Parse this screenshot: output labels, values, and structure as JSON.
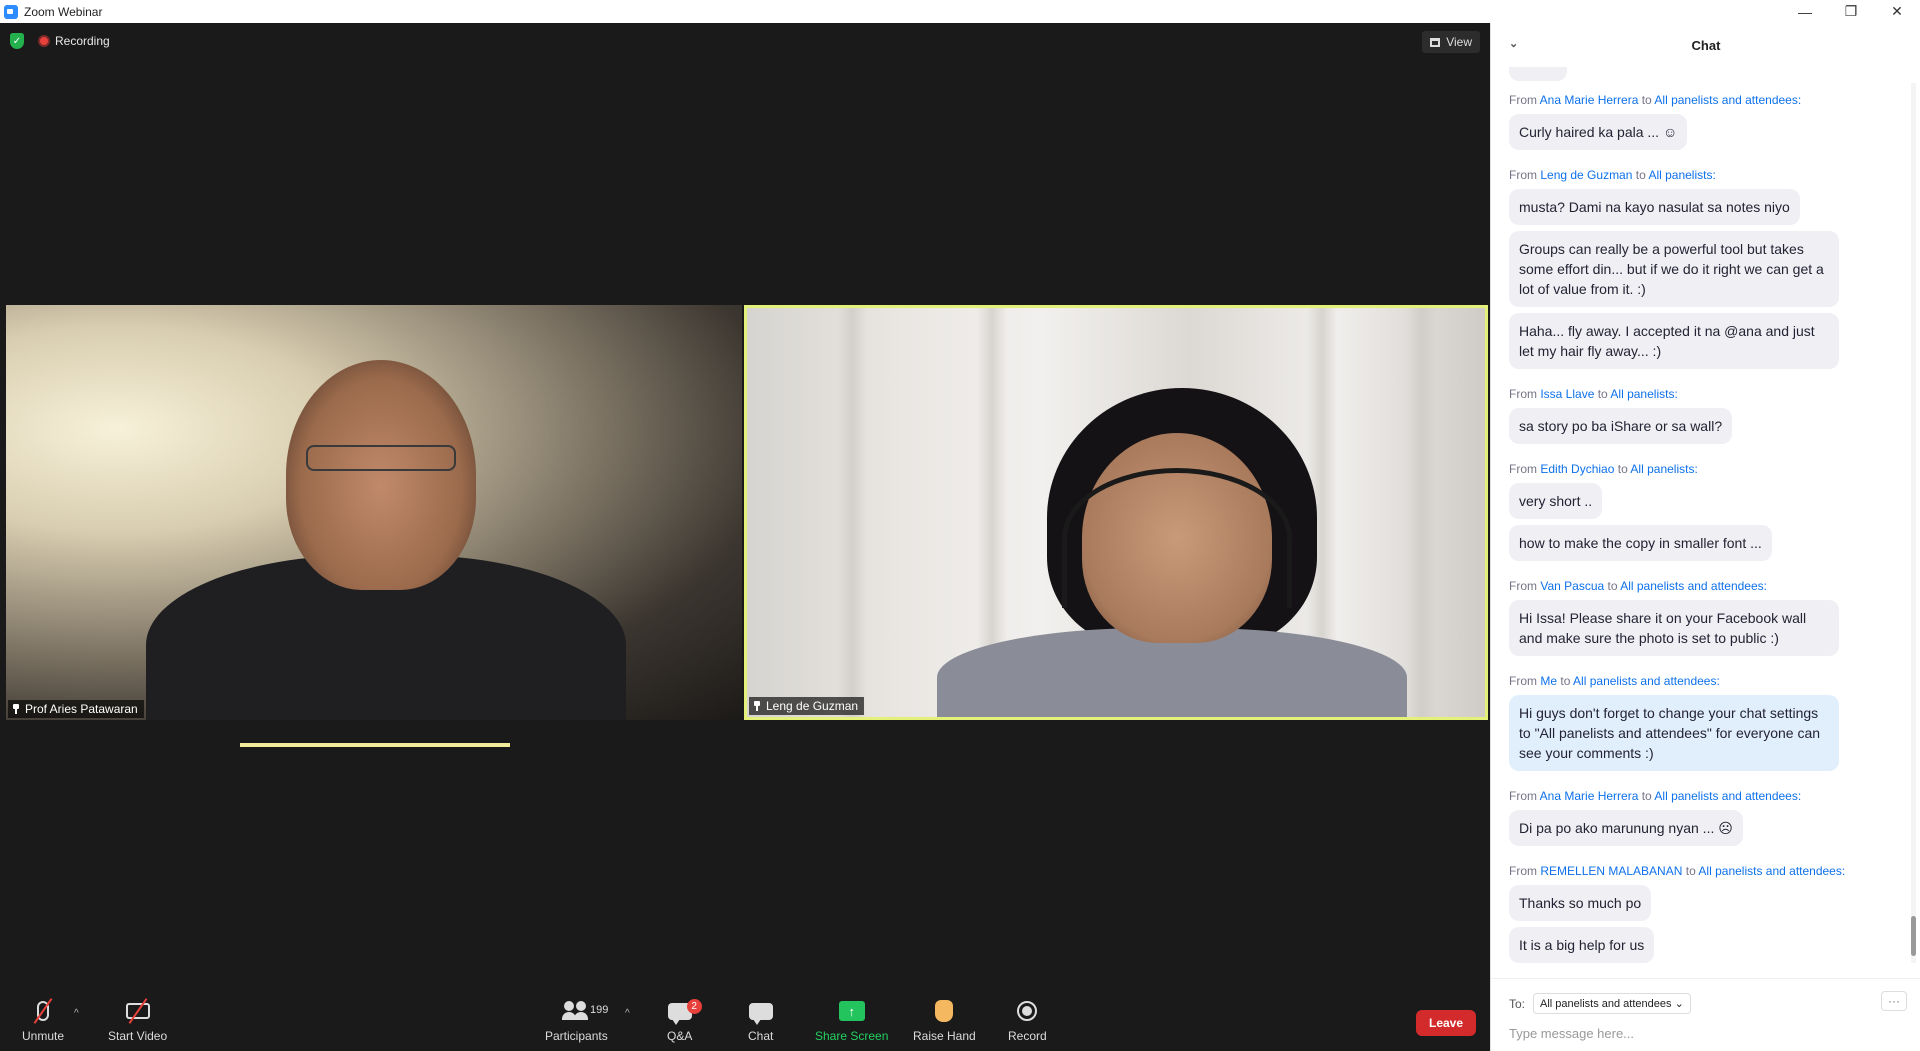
{
  "window": {
    "title": "Zoom Webinar",
    "minimize": "—",
    "restore": "❐",
    "close": "✕"
  },
  "meeting": {
    "recording_label": "Recording",
    "view_label": "View",
    "participants": [
      {
        "name": "Prof Aries Patawaran"
      },
      {
        "name": "Leng de Guzman"
      }
    ]
  },
  "toolbar": {
    "unmute": "Unmute",
    "start_video": "Start Video",
    "participants": "Participants",
    "participant_count": "199",
    "qa": "Q&A",
    "qa_badge": "2",
    "chat": "Chat",
    "share_screen": "Share Screen",
    "raise_hand": "Raise Hand",
    "record": "Record",
    "leave": "Leave",
    "caret": "^"
  },
  "chat": {
    "title": "Chat",
    "groups": [
      {
        "prefix": "From",
        "sender": "Ana Marie Herrera",
        "to": "to",
        "recipient": "All panelists and attendees:",
        "messages": [
          "Curly haired ka pala ... ☺"
        ]
      },
      {
        "prefix": "From",
        "sender": "Leng de Guzman",
        "to": "to",
        "recipient": "All panelists:",
        "messages": [
          "musta? Dami na kayo nasulat sa notes niyo",
          "Groups can really be a powerful tool but takes some effort din... but if we do it right we can get a lot of value from it. :)",
          "Haha... fly away. I accepted it na @ana and just let my hair fly away... :)"
        ]
      },
      {
        "prefix": "From",
        "sender": "Issa Llave",
        "to": "to",
        "recipient": "All panelists:",
        "messages": [
          "sa story po ba iShare or sa wall?"
        ]
      },
      {
        "prefix": "From",
        "sender": "Edith Dychiao",
        "to": "to",
        "recipient": "All panelists:",
        "messages": [
          "very short ..",
          "how to make the copy in smaller font ..."
        ]
      },
      {
        "prefix": "From",
        "sender": "Van Pascua",
        "to": "to",
        "recipient": "All panelists and attendees:",
        "messages": [
          "Hi Issa! Please share it on your Facebook wall and make sure the photo is set to public :)"
        ]
      },
      {
        "prefix": "From",
        "sender": "Me",
        "to": "to",
        "recipient": "All panelists and attendees:",
        "messages": [
          "Hi guys don't forget to change your chat settings to \"All panelists and attendees\" for everyone can see your comments :)"
        ],
        "is_me": true
      },
      {
        "prefix": "From",
        "sender": "Ana Marie Herrera",
        "to": "to",
        "recipient": "All panelists and attendees:",
        "messages": [
          "Di pa po ako marunung nyan ... ☹"
        ]
      },
      {
        "prefix": "From",
        "sender": "REMELLEN MALABANAN",
        "to": "to",
        "recipient": "All panelists and attendees:",
        "messages": [
          "Thanks so much po",
          "It is a big help for us"
        ]
      }
    ],
    "to_label": "To:",
    "to_value": "All panelists and attendees",
    "more": "···",
    "input_placeholder": "Type message here..."
  }
}
